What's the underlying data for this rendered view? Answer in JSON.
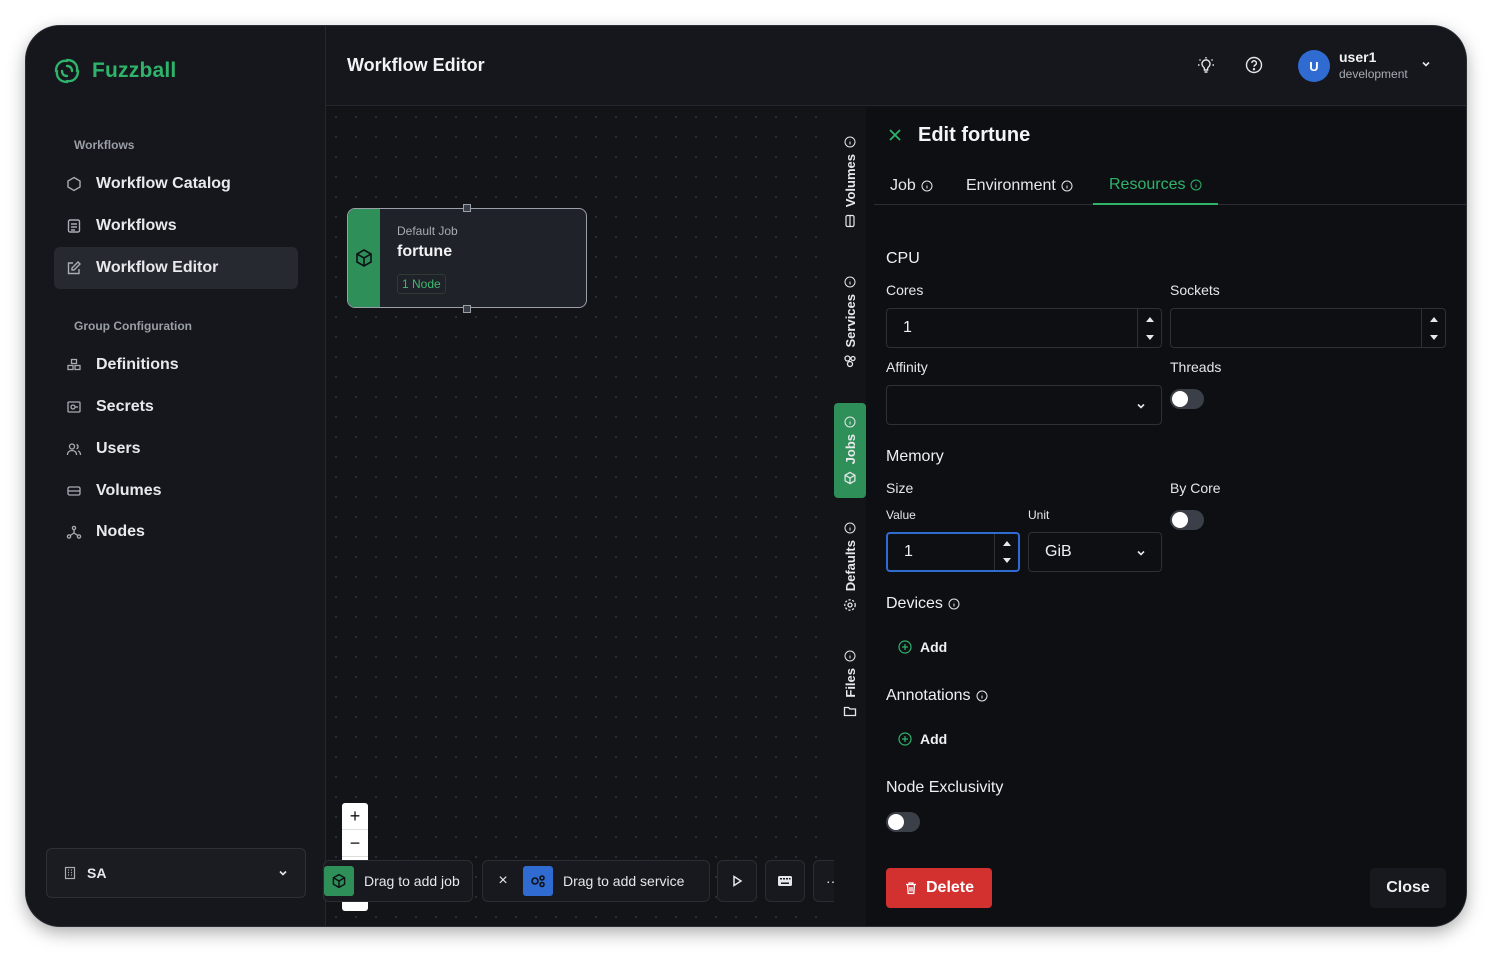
{
  "app": {
    "name": "Fuzzball"
  },
  "header": {
    "title": "Workflow Editor",
    "user": {
      "initial": "U",
      "name": "user1",
      "env": "development"
    }
  },
  "sidebar": {
    "sections": [
      {
        "label": "Workflows",
        "items": [
          {
            "label": "Workflow Catalog"
          },
          {
            "label": "Workflows"
          },
          {
            "label": "Workflow Editor",
            "active": true
          }
        ]
      },
      {
        "label": "Group Configuration",
        "items": [
          {
            "label": "Definitions"
          },
          {
            "label": "Secrets"
          },
          {
            "label": "Users"
          },
          {
            "label": "Volumes"
          },
          {
            "label": "Nodes"
          }
        ]
      }
    ],
    "org": "SA"
  },
  "canvas": {
    "node": {
      "kind": "Default Job",
      "name": "fortune",
      "badge": "1 Node"
    },
    "zoom": {
      "in": "+",
      "out": "−"
    },
    "toolbar": {
      "drag_job": "Drag to add job",
      "drag_service": "Drag to add service",
      "remove": "×",
      "more": "···"
    }
  },
  "side_tabs": [
    {
      "label": "Volumes"
    },
    {
      "label": "Services"
    },
    {
      "label": "Jobs",
      "active": true
    },
    {
      "label": "Defaults"
    },
    {
      "label": "Files"
    }
  ],
  "editor": {
    "title": "Edit fortune",
    "tabs": [
      {
        "label": "Job"
      },
      {
        "label": "Environment"
      },
      {
        "label": "Resources",
        "active": true
      }
    ],
    "cpu": {
      "title": "CPU",
      "cores_label": "Cores",
      "cores_value": "1",
      "sockets_label": "Sockets",
      "sockets_value": "",
      "affinity_label": "Affinity",
      "affinity_value": "",
      "threads_label": "Threads",
      "threads_on": false
    },
    "memory": {
      "title": "Memory",
      "size_label": "Size",
      "value_label": "Value",
      "value": "1",
      "unit_label": "Unit",
      "unit": "GiB",
      "by_core_label": "By Core",
      "by_core_on": false
    },
    "devices": {
      "title": "Devices",
      "add": "Add"
    },
    "annotations": {
      "title": "Annotations",
      "add": "Add"
    },
    "node_exclusivity": {
      "title": "Node Exclusivity",
      "on": false
    },
    "delete_label": "Delete",
    "close_label": "Close"
  },
  "colors": {
    "accent": "#2fb36b",
    "job": "#2f8f58",
    "service": "#2f6bd0",
    "danger": "#d3312f"
  }
}
